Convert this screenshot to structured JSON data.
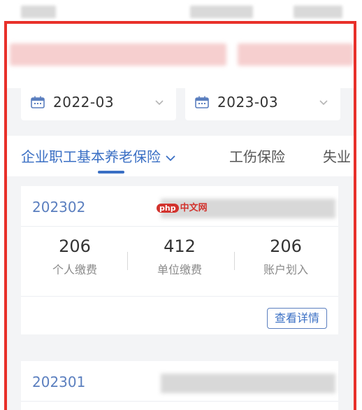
{
  "date_range": {
    "start": "2022-03",
    "end": "2023-03"
  },
  "tabs": [
    {
      "label": "企业职工基本养老保险",
      "active": true
    },
    {
      "label": "工伤保险",
      "active": false
    },
    {
      "label": "失业",
      "active": false
    }
  ],
  "records": [
    {
      "period": "202302",
      "personal_payment": "206",
      "personal_label": "个人缴费",
      "employer_payment": "412",
      "employer_label": "单位缴费",
      "account_credit": "206",
      "account_label": "账户划入",
      "detail_label": "查看详情"
    },
    {
      "period": "202301"
    }
  ],
  "watermark": {
    "logo": "php",
    "text": "中文网"
  },
  "colors": {
    "accent": "#3a6fc4",
    "highlight_border": "#e8302a"
  },
  "icons": {
    "calendar": "calendar-icon",
    "chevron": "chevron-down-icon"
  }
}
